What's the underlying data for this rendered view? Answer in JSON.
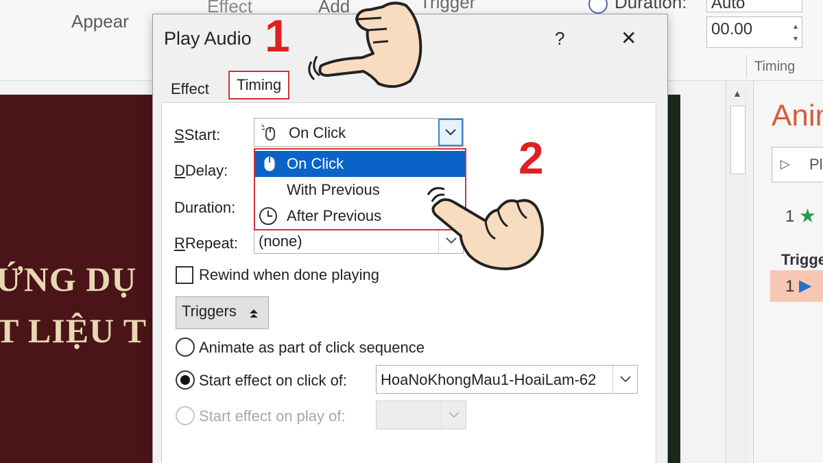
{
  "ribbon": {
    "appear_label": "Appear",
    "effect_partial": "Effect",
    "add_partial": "Add",
    "trigger_partial": "Trigger",
    "duration_label": "Duration:",
    "duration_value": "Auto",
    "delay_value": "00.00",
    "timing_group": "Timing"
  },
  "slide": {
    "line1": "ỨNG DỤ",
    "line2": "T LIỆU T"
  },
  "anim_pane": {
    "title": "Anim",
    "play_button": "Pl",
    "item_number": "1",
    "trigger_header": "Trigge",
    "trigger_item_number": "1"
  },
  "dialog": {
    "title": "Play Audio",
    "help_label": "?",
    "close_label": "✕",
    "tabs": {
      "effect": "Effect",
      "timing": "Timing"
    },
    "start_label": "Start:",
    "start_value": "On Click",
    "delay_label": "Delay:",
    "duration_label": "Duration:",
    "repeat_label": "Repeat:",
    "repeat_value": "(none)",
    "dropdown_options": [
      "On Click",
      "With Previous",
      "After Previous"
    ],
    "rewind_label": "Rewind when done playing",
    "triggers_button": "Triggers",
    "radio_sequence": "Animate as part of click sequence",
    "radio_on_click": "Start effect on click of:",
    "on_click_target": "HoaNoKhongMau1-HoaiLam-62",
    "radio_on_play": "Start effect on play of:"
  },
  "annotations": {
    "step1": "1",
    "step2": "2"
  },
  "colors": {
    "highlight_border": "#d03434",
    "selected_item": "#0a64c8",
    "step_number": "#e01f1f",
    "slide_background": "#4a1418",
    "slide_text": "#e9d7b4",
    "anim_pane_star": "#2a9a4a"
  },
  "icons": [
    "mouse-icon",
    "clock-icon",
    "chevron-down-icon",
    "star-icon",
    "play-icon",
    "collapse-icon",
    "pointing-hand-icon"
  ]
}
